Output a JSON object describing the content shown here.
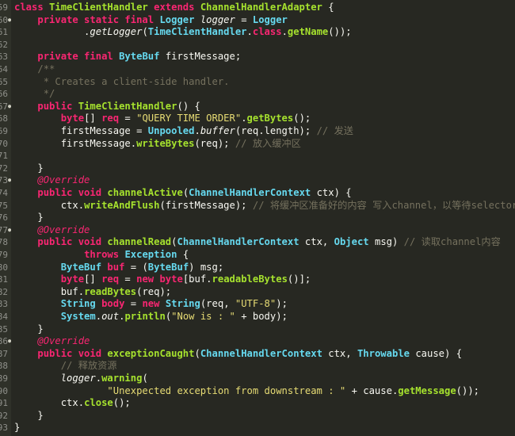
{
  "theme": {
    "background": "#272822",
    "gutter": "#2f3129",
    "keyword": "#f92672",
    "type": "#66d9ef",
    "function": "#a6e22e",
    "string": "#e6db74",
    "comment": "#75715e"
  },
  "gutter": [
    "59",
    "60",
    "61",
    "62",
    "63",
    "64",
    "65",
    "66",
    "67",
    "68",
    "69",
    "70",
    "71",
    "72",
    "73",
    "74",
    "75",
    "76",
    "77",
    "78",
    "79",
    "80",
    "81",
    "82",
    "83",
    "84",
    "85",
    "86",
    "87",
    "88",
    "89",
    "90",
    "91",
    "92",
    "93"
  ],
  "lines": [
    [
      [
        "kw",
        "class "
      ],
      [
        "fn",
        "TimeClientHandler "
      ],
      [
        "kw",
        "extends "
      ],
      [
        "fn",
        "ChannelHandlerAdapter"
      ],
      [
        "pl",
        " {"
      ]
    ],
    [
      [
        "pl",
        "    "
      ],
      [
        "kw",
        "private static final "
      ],
      [
        "ty",
        "Logger "
      ],
      [
        "it",
        "logger"
      ],
      [
        "pl",
        " = "
      ],
      [
        "ty",
        "Logger"
      ]
    ],
    [
      [
        "pl",
        "            ."
      ],
      [
        "it",
        "getLogger"
      ],
      [
        "pl",
        "("
      ],
      [
        "ty",
        "TimeClientHandler"
      ],
      [
        "pl",
        "."
      ],
      [
        "kw",
        "class"
      ],
      [
        "pl",
        "."
      ],
      [
        "fn",
        "getName"
      ],
      [
        "pl",
        "());"
      ]
    ],
    [
      [
        "pl",
        ""
      ]
    ],
    [
      [
        "pl",
        "    "
      ],
      [
        "kw",
        "private final "
      ],
      [
        "ty",
        "ByteBuf "
      ],
      [
        "pl",
        "firstMessage;"
      ]
    ],
    [
      [
        "pl",
        "    "
      ],
      [
        "cm",
        "/**"
      ]
    ],
    [
      [
        "pl",
        "    "
      ],
      [
        "cm",
        " * Creates a client-side handler."
      ]
    ],
    [
      [
        "pl",
        "    "
      ],
      [
        "cm",
        " */"
      ]
    ],
    [
      [
        "pl",
        "    "
      ],
      [
        "kw",
        "public "
      ],
      [
        "fn",
        "TimeClientHandler"
      ],
      [
        "pl",
        "() {"
      ]
    ],
    [
      [
        "pl",
        "        "
      ],
      [
        "kw",
        "byte"
      ],
      [
        "pl",
        "[] "
      ],
      [
        "kw",
        "req"
      ],
      [
        "pl",
        " = "
      ],
      [
        "st",
        "\"QUERY TIME ORDER\""
      ],
      [
        "pl",
        "."
      ],
      [
        "fn",
        "getBytes"
      ],
      [
        "pl",
        "();"
      ]
    ],
    [
      [
        "pl",
        "        firstMessage = "
      ],
      [
        "ty",
        "Unpooled"
      ],
      [
        "pl",
        "."
      ],
      [
        "it",
        "buffer"
      ],
      [
        "pl",
        "(req.length); "
      ],
      [
        "cm",
        "// 发送"
      ]
    ],
    [
      [
        "pl",
        "        firstMessage."
      ],
      [
        "fn",
        "writeBytes"
      ],
      [
        "pl",
        "(req); "
      ],
      [
        "cm",
        "// 放入缓冲区"
      ]
    ],
    [
      [
        "pl",
        ""
      ]
    ],
    [
      [
        "pl",
        "    }"
      ]
    ],
    [
      [
        "pl",
        "    "
      ],
      [
        "an",
        "@Override"
      ]
    ],
    [
      [
        "pl",
        "    "
      ],
      [
        "kw",
        "public void "
      ],
      [
        "fn",
        "channelActive"
      ],
      [
        "pl",
        "("
      ],
      [
        "ty",
        "ChannelHandlerContext"
      ],
      [
        "pl",
        " ctx) {"
      ]
    ],
    [
      [
        "pl",
        "        ctx."
      ],
      [
        "fn",
        "writeAndFlush"
      ],
      [
        "pl",
        "(firstMessage); "
      ],
      [
        "cm",
        "// 将缓冲区准备好的内容 写入channel，以等待selector调度"
      ]
    ],
    [
      [
        "pl",
        "    }"
      ]
    ],
    [
      [
        "pl",
        "    "
      ],
      [
        "an",
        "@Override"
      ]
    ],
    [
      [
        "pl",
        "    "
      ],
      [
        "kw",
        "public void "
      ],
      [
        "fn",
        "channelRead"
      ],
      [
        "pl",
        "("
      ],
      [
        "ty",
        "ChannelHandlerContext"
      ],
      [
        "pl",
        " ctx, "
      ],
      [
        "ty",
        "Object"
      ],
      [
        "pl",
        " msg) "
      ],
      [
        "cm",
        "// 读取channel内容"
      ]
    ],
    [
      [
        "pl",
        "            "
      ],
      [
        "kw",
        "throws "
      ],
      [
        "ty",
        "Exception"
      ],
      [
        "pl",
        " {"
      ]
    ],
    [
      [
        "pl",
        "        "
      ],
      [
        "ty",
        "ByteBuf"
      ],
      [
        "pl",
        " "
      ],
      [
        "kw",
        "buf"
      ],
      [
        "pl",
        " = ("
      ],
      [
        "ty",
        "ByteBuf"
      ],
      [
        "pl",
        ") msg;"
      ]
    ],
    [
      [
        "pl",
        "        "
      ],
      [
        "kw",
        "byte"
      ],
      [
        "pl",
        "[] "
      ],
      [
        "kw",
        "req"
      ],
      [
        "pl",
        " = "
      ],
      [
        "kw",
        "new "
      ],
      [
        "kw",
        "byte"
      ],
      [
        "pl",
        "[buf."
      ],
      [
        "fn",
        "readableBytes"
      ],
      [
        "pl",
        "()];"
      ]
    ],
    [
      [
        "pl",
        "        buf."
      ],
      [
        "fn",
        "readBytes"
      ],
      [
        "pl",
        "(req);"
      ]
    ],
    [
      [
        "pl",
        "        "
      ],
      [
        "ty",
        "String"
      ],
      [
        "pl",
        " "
      ],
      [
        "kw",
        "body"
      ],
      [
        "pl",
        " = "
      ],
      [
        "kw",
        "new "
      ],
      [
        "ty",
        "String"
      ],
      [
        "pl",
        "(req, "
      ],
      [
        "st",
        "\"UTF-8\""
      ],
      [
        "pl",
        ");"
      ]
    ],
    [
      [
        "pl",
        "        "
      ],
      [
        "ty",
        "System"
      ],
      [
        "pl",
        "."
      ],
      [
        "it",
        "out"
      ],
      [
        "pl",
        "."
      ],
      [
        "fn",
        "println"
      ],
      [
        "pl",
        "("
      ],
      [
        "st",
        "\"Now is : \""
      ],
      [
        "pl",
        " + body);"
      ]
    ],
    [
      [
        "pl",
        "    }"
      ]
    ],
    [
      [
        "pl",
        "    "
      ],
      [
        "an",
        "@Override"
      ]
    ],
    [
      [
        "pl",
        "    "
      ],
      [
        "kw",
        "public void "
      ],
      [
        "fn",
        "exceptionCaught"
      ],
      [
        "pl",
        "("
      ],
      [
        "ty",
        "ChannelHandlerContext"
      ],
      [
        "pl",
        " ctx, "
      ],
      [
        "ty",
        "Throwable"
      ],
      [
        "pl",
        " cause) {"
      ]
    ],
    [
      [
        "pl",
        "        "
      ],
      [
        "cm",
        "// 释放资源"
      ]
    ],
    [
      [
        "pl",
        "        "
      ],
      [
        "it",
        "logger"
      ],
      [
        "pl",
        "."
      ],
      [
        "fn",
        "warning"
      ],
      [
        "pl",
        "("
      ]
    ],
    [
      [
        "pl",
        "                "
      ],
      [
        "st",
        "\"Unexpected exception from downstream : \""
      ],
      [
        "pl",
        " + cause."
      ],
      [
        "fn",
        "getMessage"
      ],
      [
        "pl",
        "());"
      ]
    ],
    [
      [
        "pl",
        "        ctx."
      ],
      [
        "fn",
        "close"
      ],
      [
        "pl",
        "();"
      ]
    ],
    [
      [
        "pl",
        "    }"
      ]
    ],
    [
      [
        "pl",
        "}"
      ]
    ]
  ],
  "fold_markers": [
    1,
    8,
    14,
    18,
    27
  ]
}
